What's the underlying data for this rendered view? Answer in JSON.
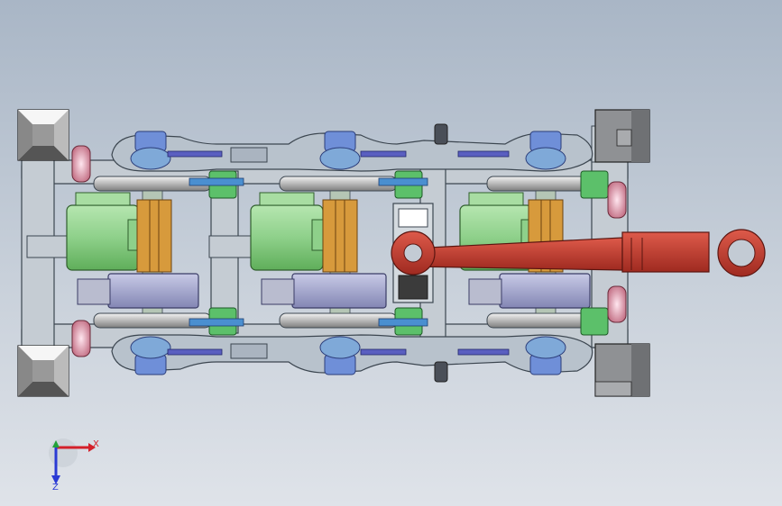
{
  "viewport": {
    "background_top": "#a9b6c6",
    "background_bottom": "#dfe3e9"
  },
  "colors": {
    "frame": "#c5ccd3",
    "frame_edge": "#3c4650",
    "motor": "#8ed08a",
    "gearbox": "#d79a3c",
    "wheel": "#c9c9c9",
    "axle_box": "#7fa9d8",
    "spring": "#6f8fd8",
    "link": "#5a5fc0",
    "brake": "#5cc06a",
    "damper": "#d98ea0",
    "traction_rod": "#c0392b",
    "battery": "#a3a6c8",
    "corner_block": "#9a9a9a"
  },
  "triad": {
    "x_label": "X",
    "z_label": "Z",
    "x_color": "#d4202a",
    "y_color": "#23a23a",
    "z_color": "#2a3ad4"
  }
}
